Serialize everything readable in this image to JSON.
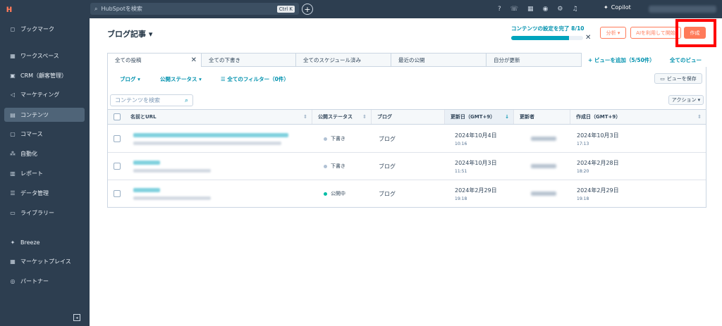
{
  "topbar": {
    "logo": "ʜ",
    "search_placeholder": "HubSpotを検索",
    "search_shortcut": "Ctrl K",
    "add_icon": "+",
    "copilot_icon": "✦",
    "copilot_label": "Copilot"
  },
  "sidebar": {
    "items": [
      {
        "icon": "bookmark-icon",
        "glyph": "◻",
        "label": "ブックマーク"
      },
      {
        "icon": "workspace-icon",
        "glyph": "▦",
        "label": "ワークスペース"
      },
      {
        "icon": "crm-icon",
        "glyph": "▣",
        "label": "CRM（顧客管理）"
      },
      {
        "icon": "megaphone-icon",
        "glyph": "◁",
        "label": "マーケティング"
      },
      {
        "icon": "content-icon",
        "glyph": "▤",
        "label": "コンテンツ"
      },
      {
        "icon": "commerce-icon",
        "glyph": "▢",
        "label": "コマース"
      },
      {
        "icon": "automation-icon",
        "glyph": "⁂",
        "label": "自動化"
      },
      {
        "icon": "report-icon",
        "glyph": "▥",
        "label": "レポート"
      },
      {
        "icon": "database-icon",
        "glyph": "☰",
        "label": "データ管理"
      },
      {
        "icon": "folder-icon",
        "glyph": "▭",
        "label": "ライブラリー"
      },
      {
        "icon": "breeze-icon",
        "glyph": "✦",
        "label": "Breeze"
      },
      {
        "icon": "marketplace-icon",
        "glyph": "▦",
        "label": "マーケットプレイス"
      },
      {
        "icon": "partner-icon",
        "glyph": "◎",
        "label": "パートナー"
      }
    ],
    "collapse_glyph": "◂"
  },
  "header": {
    "title": "ブログ記事 ▾",
    "progress_label": "コンテンツの設定を完了 8/10",
    "progress_value": 0.8,
    "progress_close": "✕",
    "analyze_label": "分析 ▾",
    "ai_label": "AIを利用して開始",
    "create_label": "作成"
  },
  "tabs": [
    {
      "label": "全ての投稿",
      "close": "✕"
    },
    {
      "label": "全ての下書き"
    },
    {
      "label": "全てのスケジュール済み"
    },
    {
      "label": "最近の公開"
    },
    {
      "label": "自分が更新"
    }
  ],
  "view_links": {
    "add_view": "+  ビューを追加（5/50件）",
    "all_views": "全てのビュー"
  },
  "filters": {
    "blog": "ブログ ▾",
    "status": "公開ステータス ▾",
    "all_filters": "☰  全てのフィルター（0件）",
    "save_view": "ビューを保存",
    "save_icon": "▭"
  },
  "search": {
    "placeholder": "コンテンツを検索",
    "icon": "🔍",
    "action_label": "アクション ▾"
  },
  "table": {
    "columns": [
      {
        "label": "名前とURL",
        "sort": "⇕"
      },
      {
        "label": "公開ステータス",
        "sort": "⇕"
      },
      {
        "label": "ブログ",
        "sort": ""
      },
      {
        "label": "更新日（GMT+9）",
        "sort": "↓"
      },
      {
        "label": "更新者",
        "sort": ""
      },
      {
        "label": "作成日（GMT+9）",
        "sort": "⇕"
      }
    ],
    "rows": [
      {
        "status": "下書き",
        "live": false,
        "blog": "ブログ",
        "updated_date": "2024年10月4日",
        "updated_time": "10:16",
        "created_date": "2024年10月3日",
        "created_time": "17:13"
      },
      {
        "status": "下書き",
        "live": false,
        "blog": "ブログ",
        "updated_date": "2024年10月3日",
        "updated_time": "11:51",
        "created_date": "2024年2月28日",
        "created_time": "18:20"
      },
      {
        "status": "公開中",
        "live": true,
        "blog": "ブログ",
        "updated_date": "2024年2月29日",
        "updated_time": "19:18",
        "created_date": "2024年2月29日",
        "created_time": "19:18"
      }
    ]
  },
  "colors": {
    "accent": "#ff7a59",
    "link": "#0091ae",
    "sidebar": "#2d3e50",
    "highlight": "#ff0000"
  }
}
